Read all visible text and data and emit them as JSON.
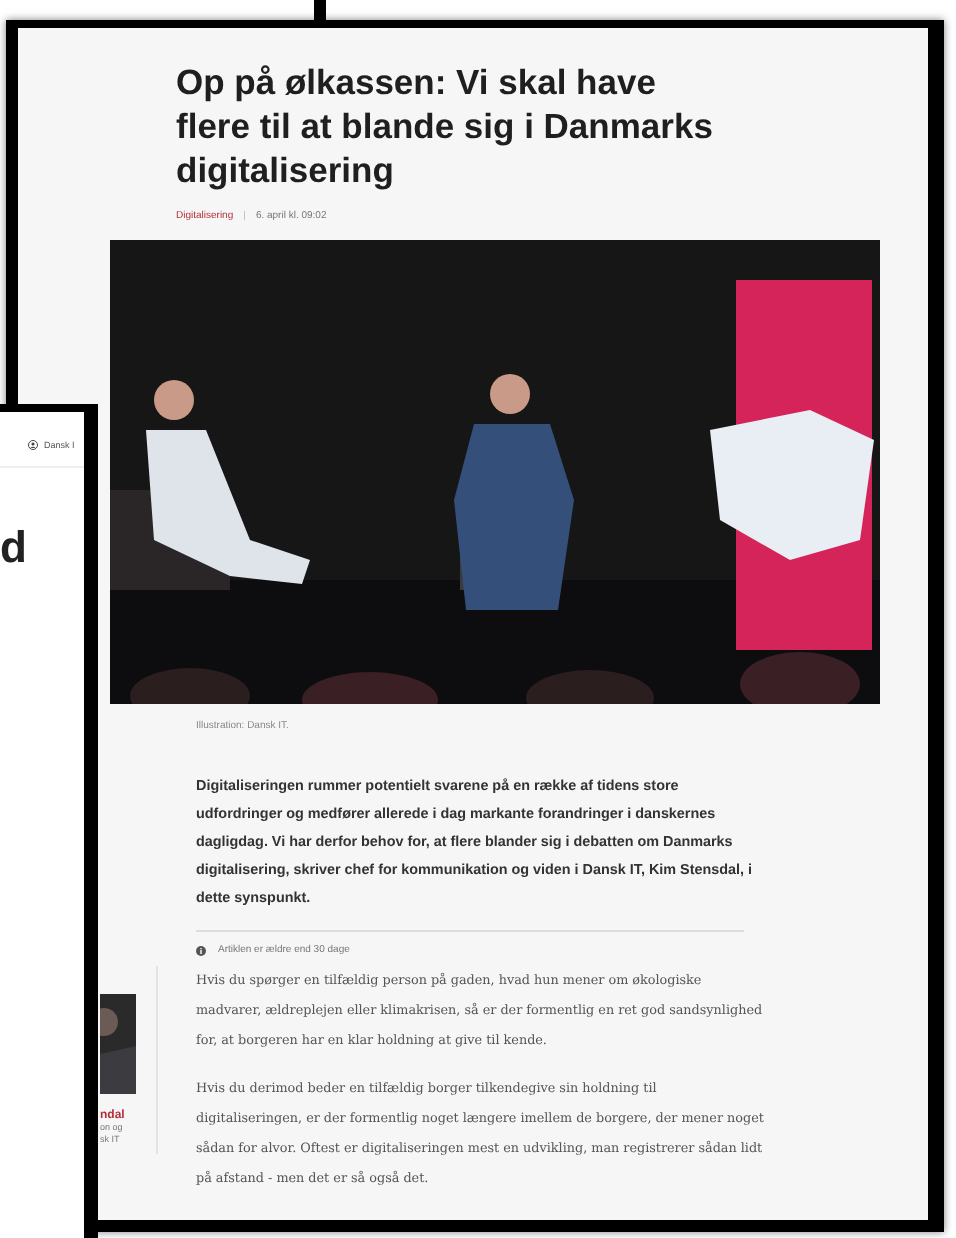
{
  "back_window": {
    "header_label": "Dansk I",
    "heading_fragment": "d"
  },
  "article": {
    "title": "Op på ølkassen: Vi skal have flere til at blande sig i Danmarks digitalisering",
    "category": "Digitalisering",
    "separator": "|",
    "date": "6. april kl. 09:02",
    "caption": "Illustration: Dansk IT.",
    "lead": "Digitaliseringen rummer potentielt svarene på en række af tidens store udfordringer og medfører allerede i dag markante forandringer i danskernes dagligdag. Vi har derfor behov for, at flere blander sig i debatten om Danmarks digitalisering, skriver chef for kommunikation og viden i Dansk IT, Kim Stensdal, i dette synspunkt.",
    "notice": "Artiklen er ældre end 30 dage",
    "author_fragments": [
      {
        "kind": "name",
        "text": "ndal"
      },
      {
        "kind": "role",
        "text": "on og"
      },
      {
        "kind": "role",
        "text": "sk IT"
      }
    ],
    "paragraphs": [
      "Hvis du spørger en tilfældig person på gaden, hvad hun mener om økologiske madvarer, ældreplejen eller klimakrisen, så er der formentlig en ret god sandsynlighed for, at borgeren har en klar holdning at give til kende.",
      "Hvis du derimod beder en tilfældig borger tilkendegive sin holdning til digitaliseringen, er der formentlig noget længere imellem de borgere, der mener noget sådan for alvor. Oftest er digitaliseringen mest en udvikling, man registrerer sådan lidt på afstand - men det er så også det."
    ]
  }
}
